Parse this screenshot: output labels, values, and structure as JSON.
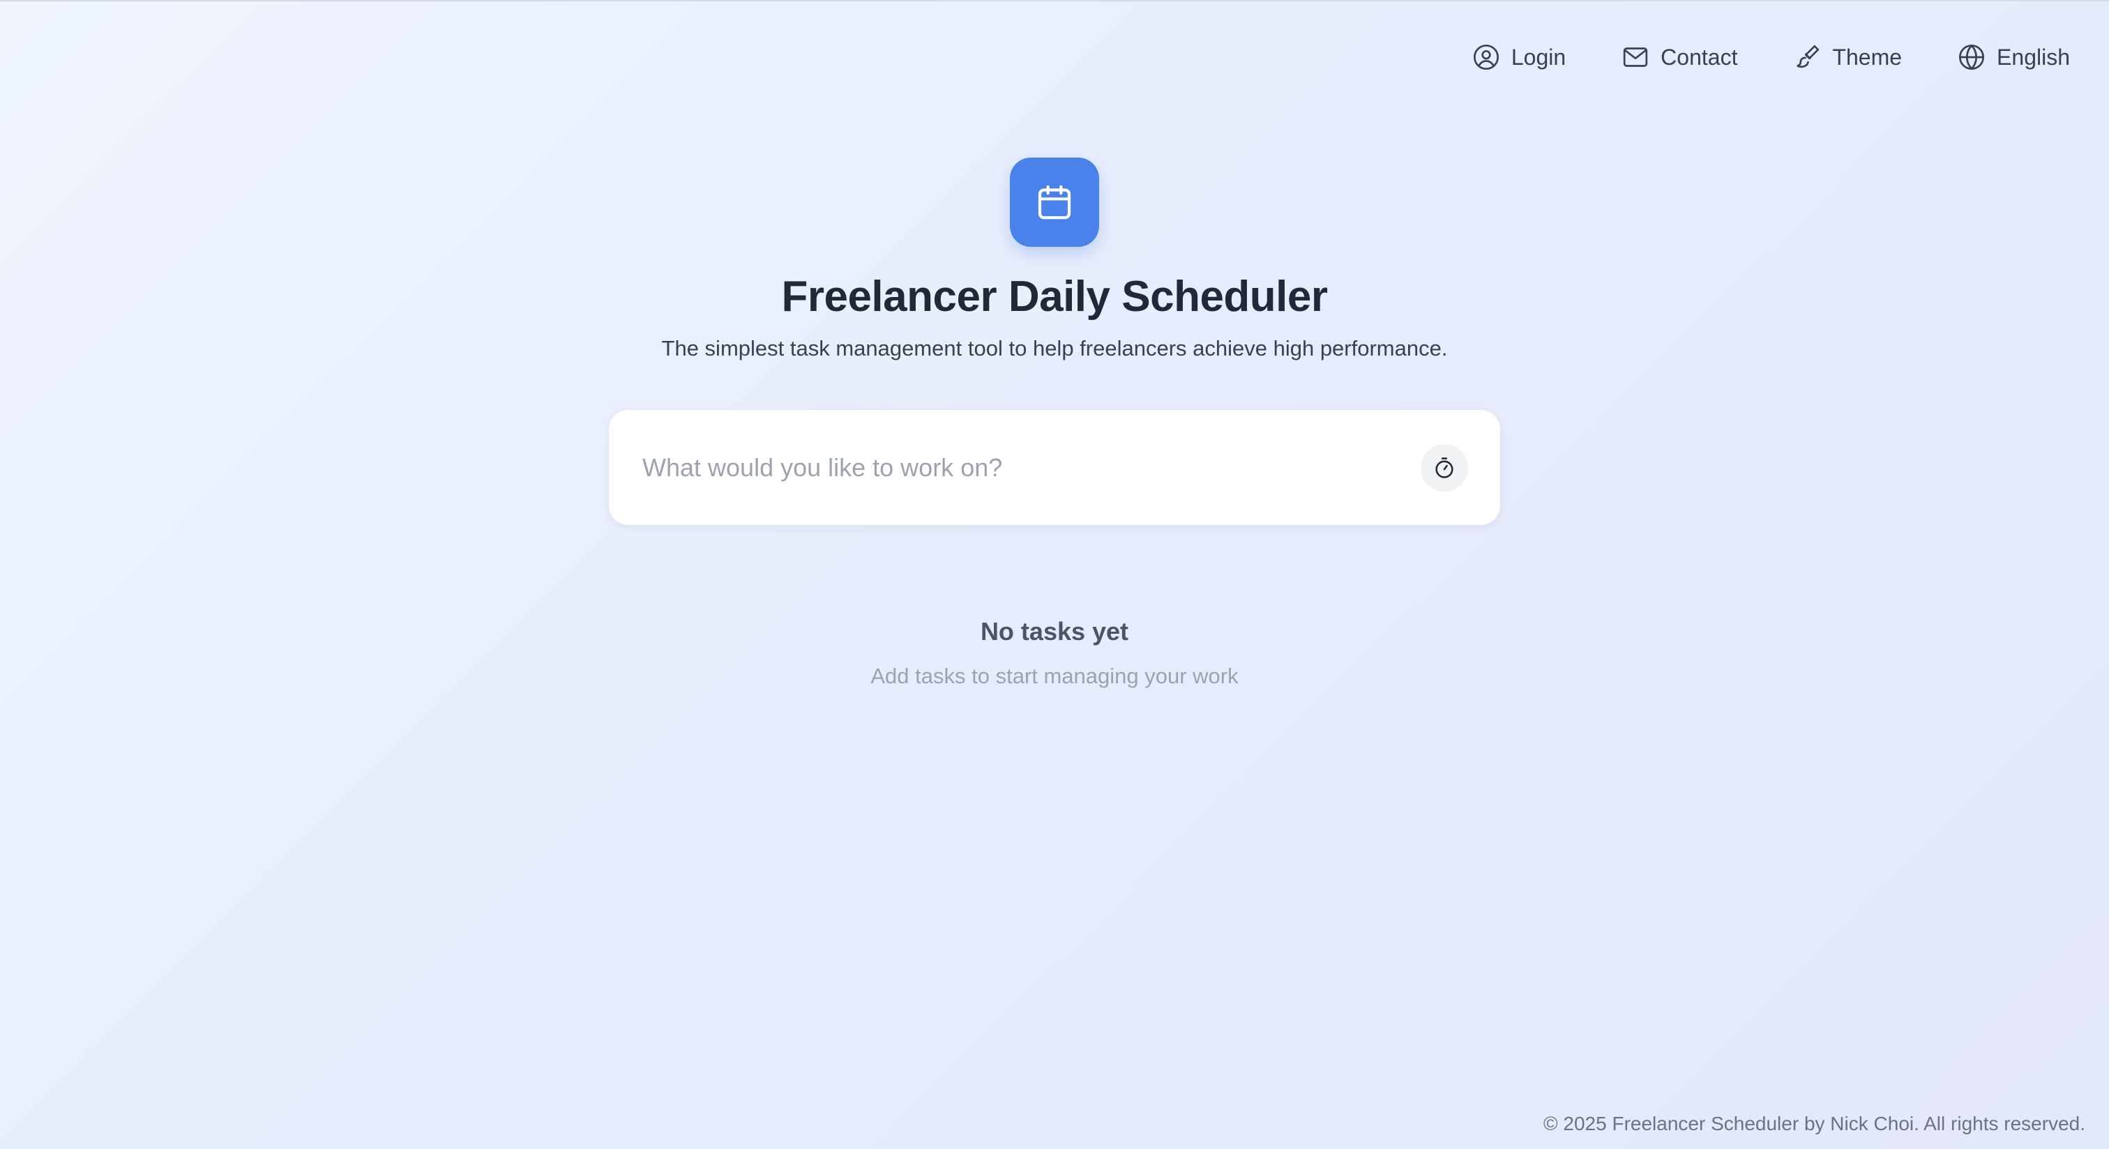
{
  "nav": {
    "items": [
      {
        "label": "Login",
        "icon": "user-circle-icon"
      },
      {
        "label": "Contact",
        "icon": "mail-icon"
      },
      {
        "label": "Theme",
        "icon": "paint-brush-icon"
      },
      {
        "label": "English",
        "icon": "globe-icon"
      }
    ]
  },
  "hero": {
    "logo_icon": "calendar-icon",
    "title": "Freelancer Daily Scheduler",
    "subtitle": "The simplest task management tool to help freelancers achieve high performance."
  },
  "task_input": {
    "value": "",
    "placeholder": "What would you like to work on?",
    "action_icon": "timer-icon"
  },
  "empty_state": {
    "title": "No tasks yet",
    "subtitle": "Add tasks to start managing your work"
  },
  "footer": {
    "text": "© 2025 Freelancer Scheduler by Nick Choi. All rights reserved."
  },
  "colors": {
    "accent": "#4a82ec",
    "background_start": "#eff4ff",
    "background_end": "#e3e8fa",
    "title": "#1f2937",
    "muted": "#9ca3af"
  }
}
